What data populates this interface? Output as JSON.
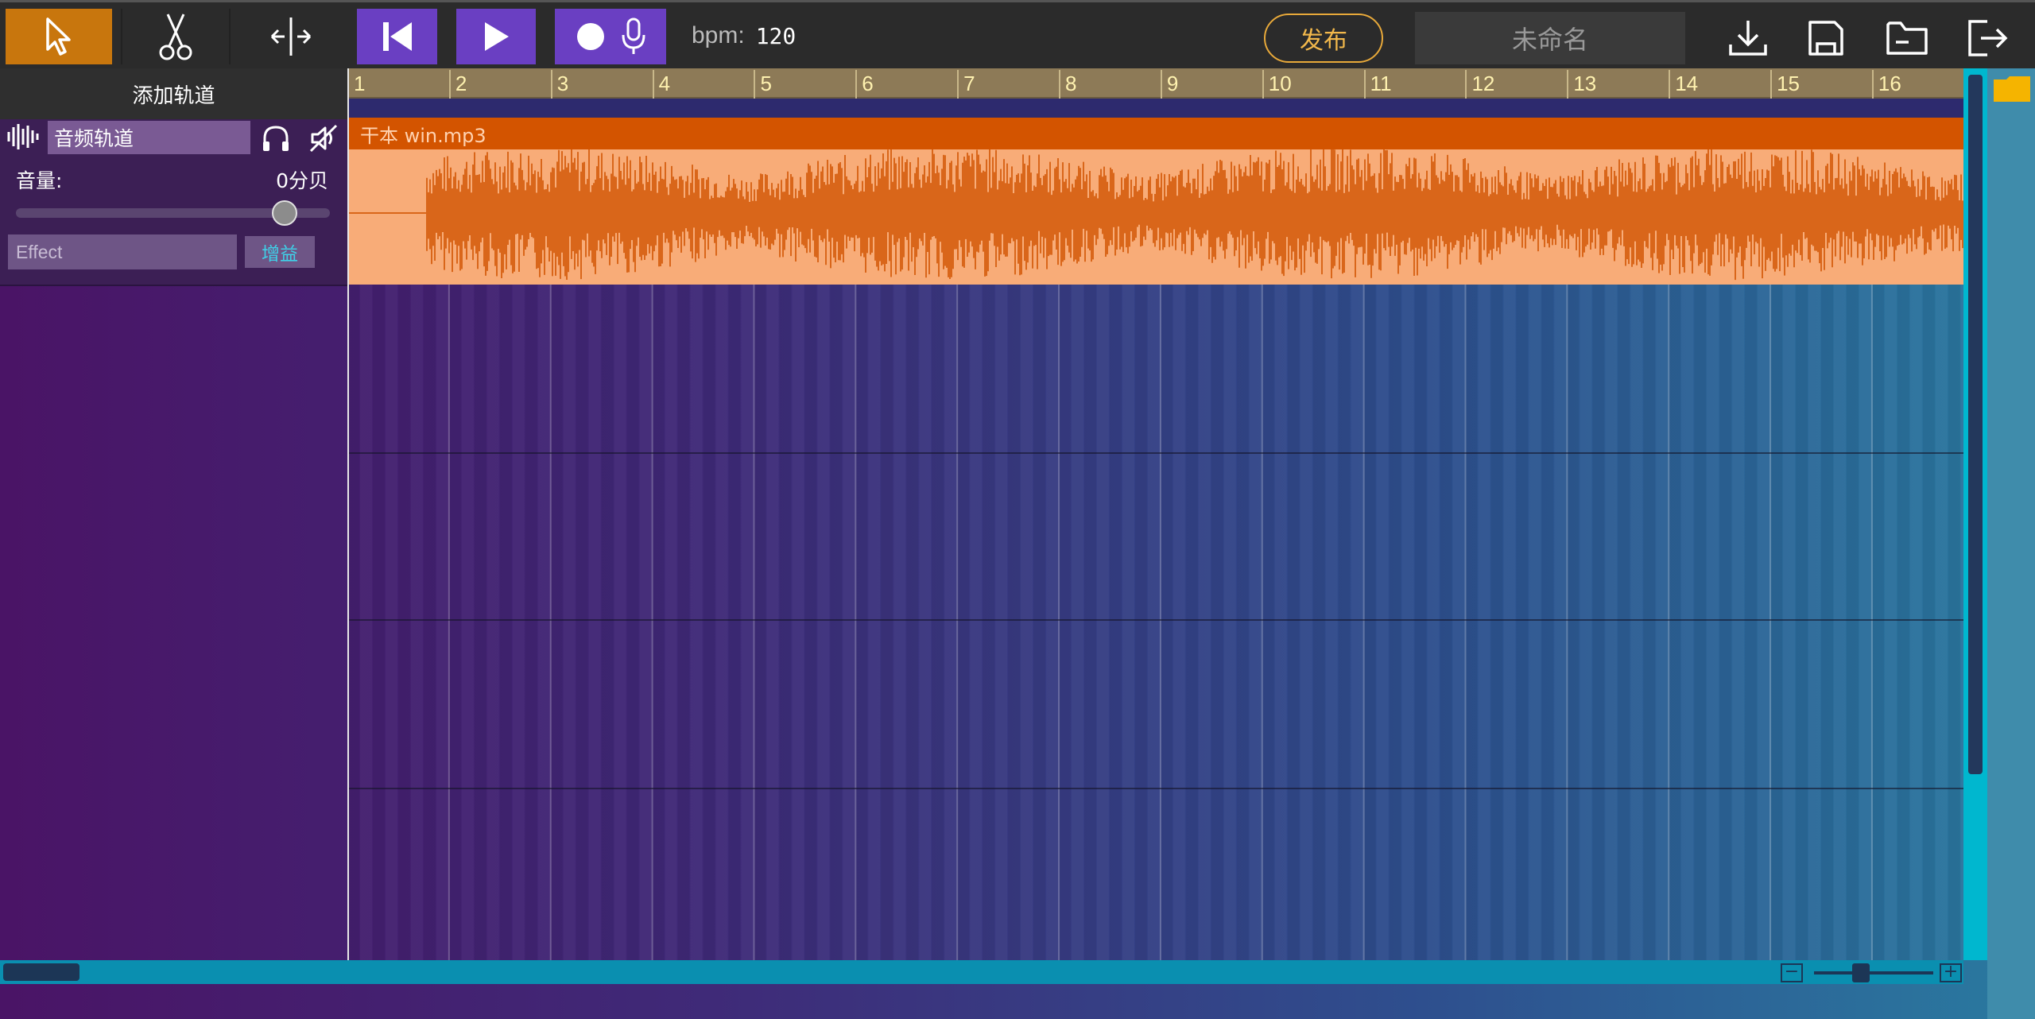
{
  "toolbar": {
    "bpm_label": "bpm:",
    "bpm_value": "120",
    "publish_label": "发布",
    "project_name": "未命名",
    "accent_color": "#c8760d",
    "transport_color": "#6a3fc2"
  },
  "left_panel": {
    "add_track_label": "添加轨道",
    "track": {
      "name": "音频轨道",
      "volume_label": "音量:",
      "volume_value": "0分贝",
      "volume_level": 0.87,
      "effect_placeholder": "Effect",
      "gain_label": "增益"
    }
  },
  "timeline": {
    "ruler": [
      "1",
      "2",
      "3",
      "4",
      "5",
      "6",
      "7",
      "8",
      "9",
      "10",
      "11",
      "12",
      "13",
      "14",
      "15",
      "16"
    ],
    "clip": {
      "name": "干本 win.mp3",
      "header_color": "#d35400",
      "body_color": "#f8ac78",
      "wave_color": "#d9661a"
    }
  },
  "icons": {
    "select": "cursor-arrow-icon",
    "cut": "scissors-icon",
    "split": "split-icon",
    "rewind": "skip-back-icon",
    "play": "play-icon",
    "record": "record-icon",
    "mic": "microphone-icon",
    "download": "download-icon",
    "save": "save-icon",
    "open": "folder-icon",
    "exit": "logout-icon"
  }
}
